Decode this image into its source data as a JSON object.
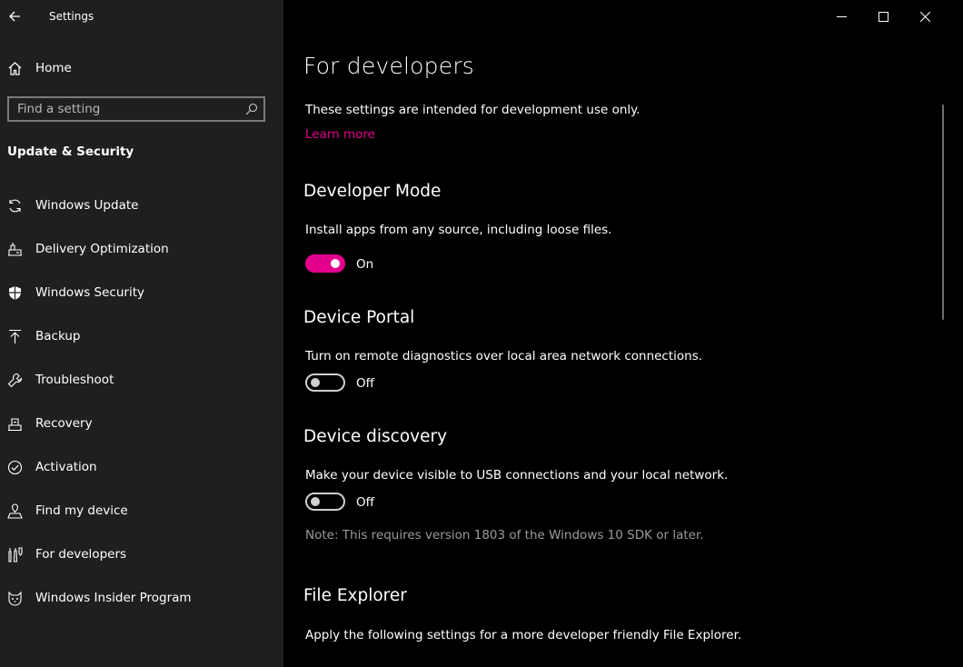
{
  "window": {
    "app_title": "Settings",
    "controls": {
      "minimize": "minimize-icon",
      "maximize": "maximize-icon",
      "close": "close-icon"
    }
  },
  "sidebar": {
    "home_label": "Home",
    "search": {
      "value": "",
      "placeholder": "Find a setting"
    },
    "section_title": "Update & Security",
    "items": [
      {
        "label": "Windows Update",
        "icon": "sync-icon"
      },
      {
        "label": "Delivery Optimization",
        "icon": "delivery-optimization-icon"
      },
      {
        "label": "Windows Security",
        "icon": "shield-icon"
      },
      {
        "label": "Backup",
        "icon": "backup-icon"
      },
      {
        "label": "Troubleshoot",
        "icon": "wrench-icon"
      },
      {
        "label": "Recovery",
        "icon": "recovery-icon"
      },
      {
        "label": "Activation",
        "icon": "check-circle-icon"
      },
      {
        "label": "Find my device",
        "icon": "find-device-icon"
      },
      {
        "label": "For developers",
        "icon": "developer-tools-icon"
      },
      {
        "label": "Windows Insider Program",
        "icon": "insider-cat-icon"
      }
    ]
  },
  "content": {
    "title": "For developers",
    "intro": "These settings are intended for development use only.",
    "learn_more": "Learn more",
    "developer_mode": {
      "heading": "Developer Mode",
      "description": "Install apps from any source, including loose files.",
      "toggle": true,
      "state_label": "On"
    },
    "device_portal": {
      "heading": "Device Portal",
      "description": "Turn on remote diagnostics over local area network connections.",
      "toggle": false,
      "state_label": "Off"
    },
    "device_discovery": {
      "heading": "Device discovery",
      "description": "Make your device visible to USB connections and your local network.",
      "toggle": false,
      "state_label": "Off",
      "note": "Note: This requires version 1803 of the Windows 10 SDK or later."
    },
    "file_explorer": {
      "heading": "File Explorer",
      "description": "Apply the following settings for a more developer friendly File Explorer."
    }
  },
  "colors": {
    "accent": "#e3008c",
    "sidebar_bg": "#1f1f1f",
    "content_bg": "#000000",
    "note_text": "#9a9a9a"
  }
}
